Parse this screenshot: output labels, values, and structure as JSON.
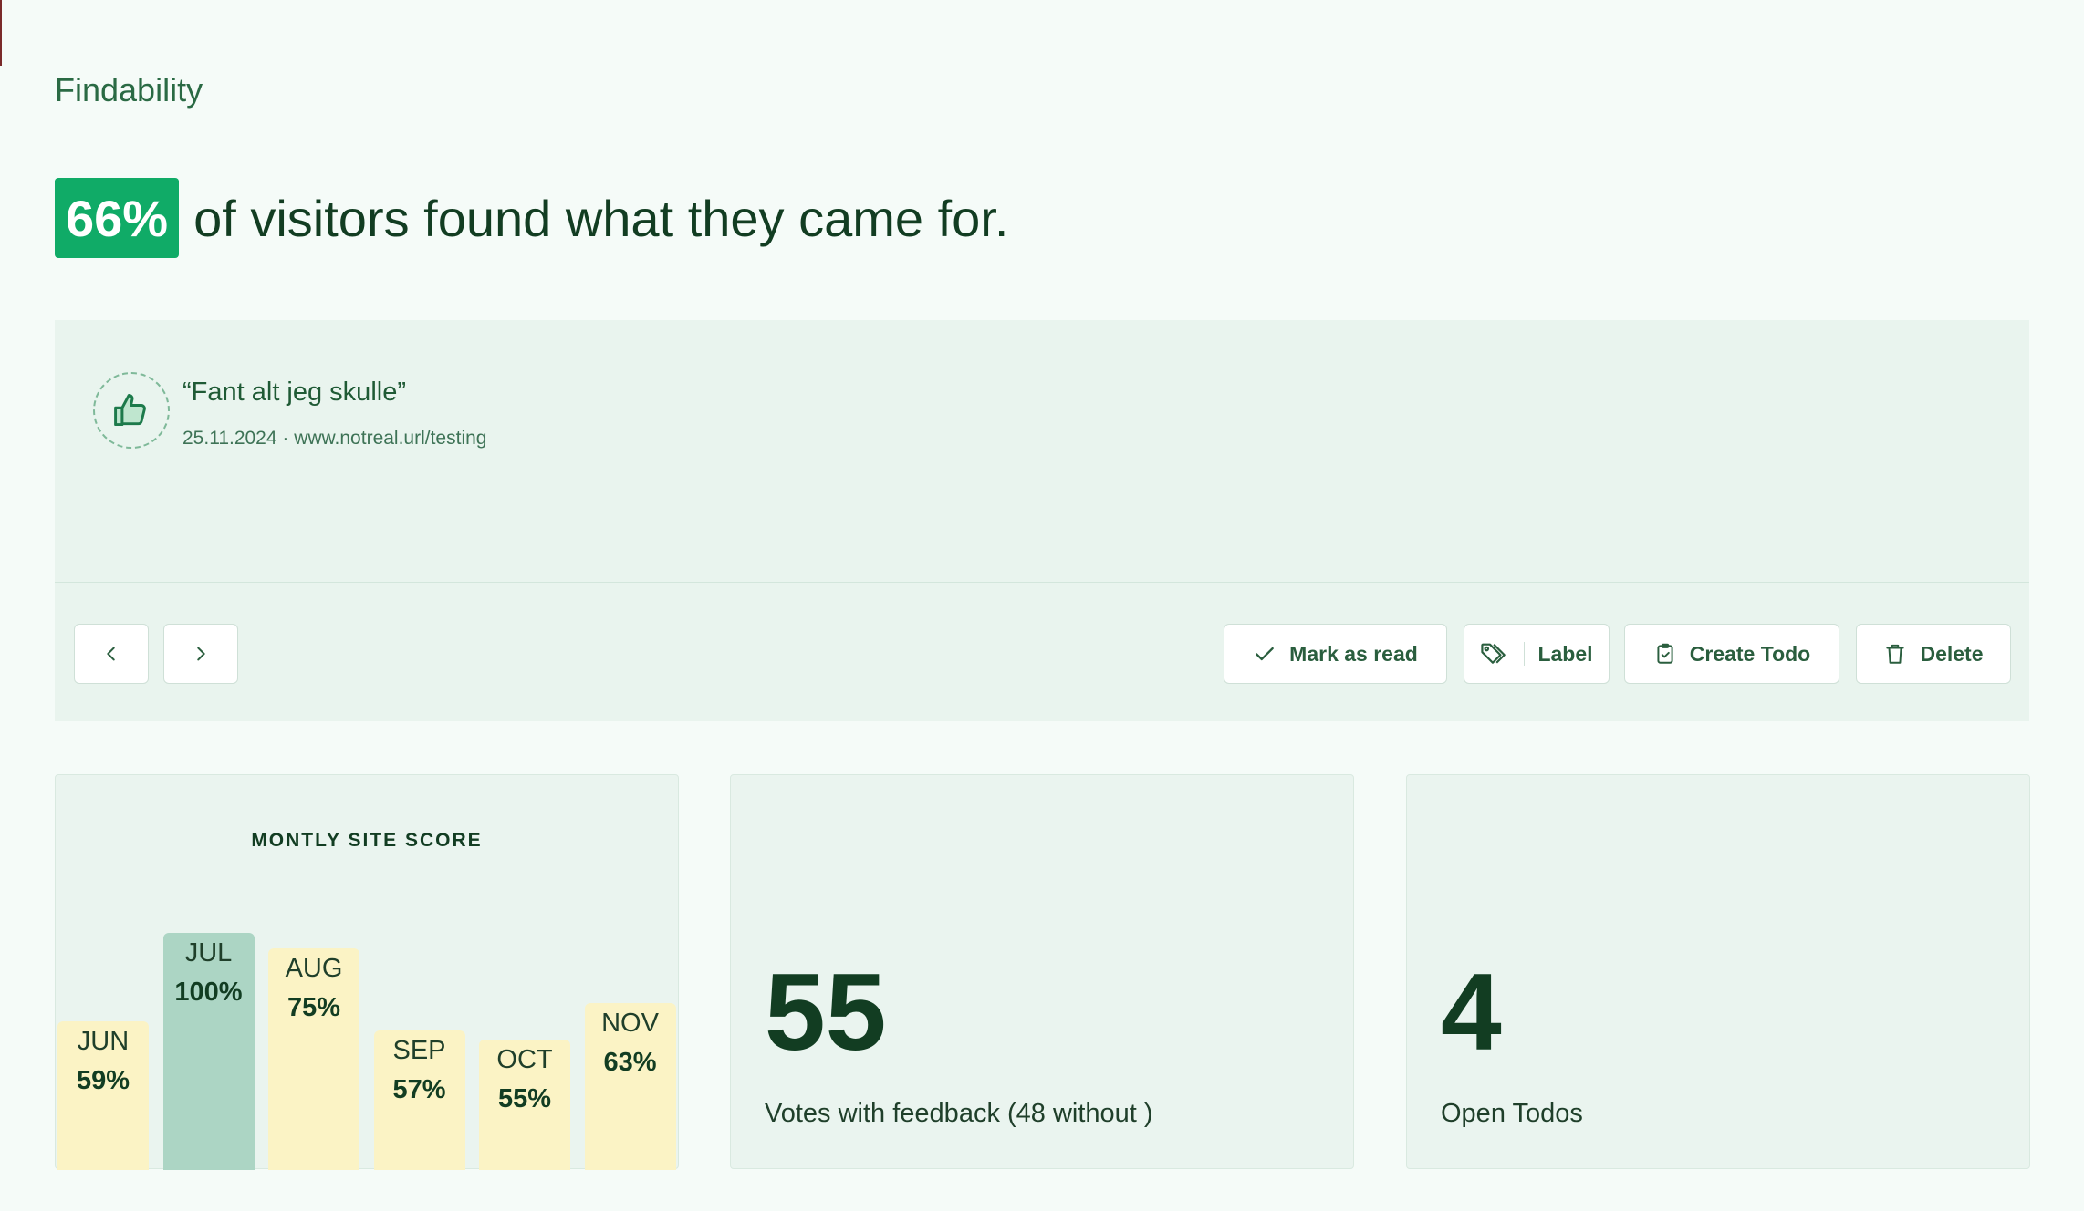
{
  "section": {
    "title": "Findability"
  },
  "headline": {
    "percent": "66%",
    "text": "of visitors found what they came for."
  },
  "feedback": {
    "quote": "“Fant alt jeg skulle”",
    "meta": "25.11.2024 · www.notreal.url/testing",
    "icon": "thumbs-up-icon"
  },
  "actions": {
    "prev_icon": "chevron-left-icon",
    "next_icon": "chevron-right-icon",
    "mark_read": "Mark as read",
    "label": "Label",
    "create_todo": "Create Todo",
    "delete": "Delete"
  },
  "chart_data": {
    "type": "bar",
    "title": "MONTLY SITE SCORE",
    "categories": [
      "JUN",
      "JUL",
      "AUG",
      "SEP",
      "OCT",
      "NOV"
    ],
    "values": [
      59,
      100,
      75,
      57,
      55,
      63
    ],
    "value_labels": [
      "59%",
      "100%",
      "75%",
      "57%",
      "55%",
      "63%"
    ],
    "highlight_index": 1,
    "colors": {
      "default": "#fbf3c5",
      "highlight": "#acd5c4"
    },
    "ylim": [
      0,
      100
    ]
  },
  "stats": {
    "votes": {
      "value": "55",
      "caption": "Votes with feedback (48 without )"
    },
    "todos": {
      "value": "4",
      "caption": "Open Todos"
    }
  }
}
